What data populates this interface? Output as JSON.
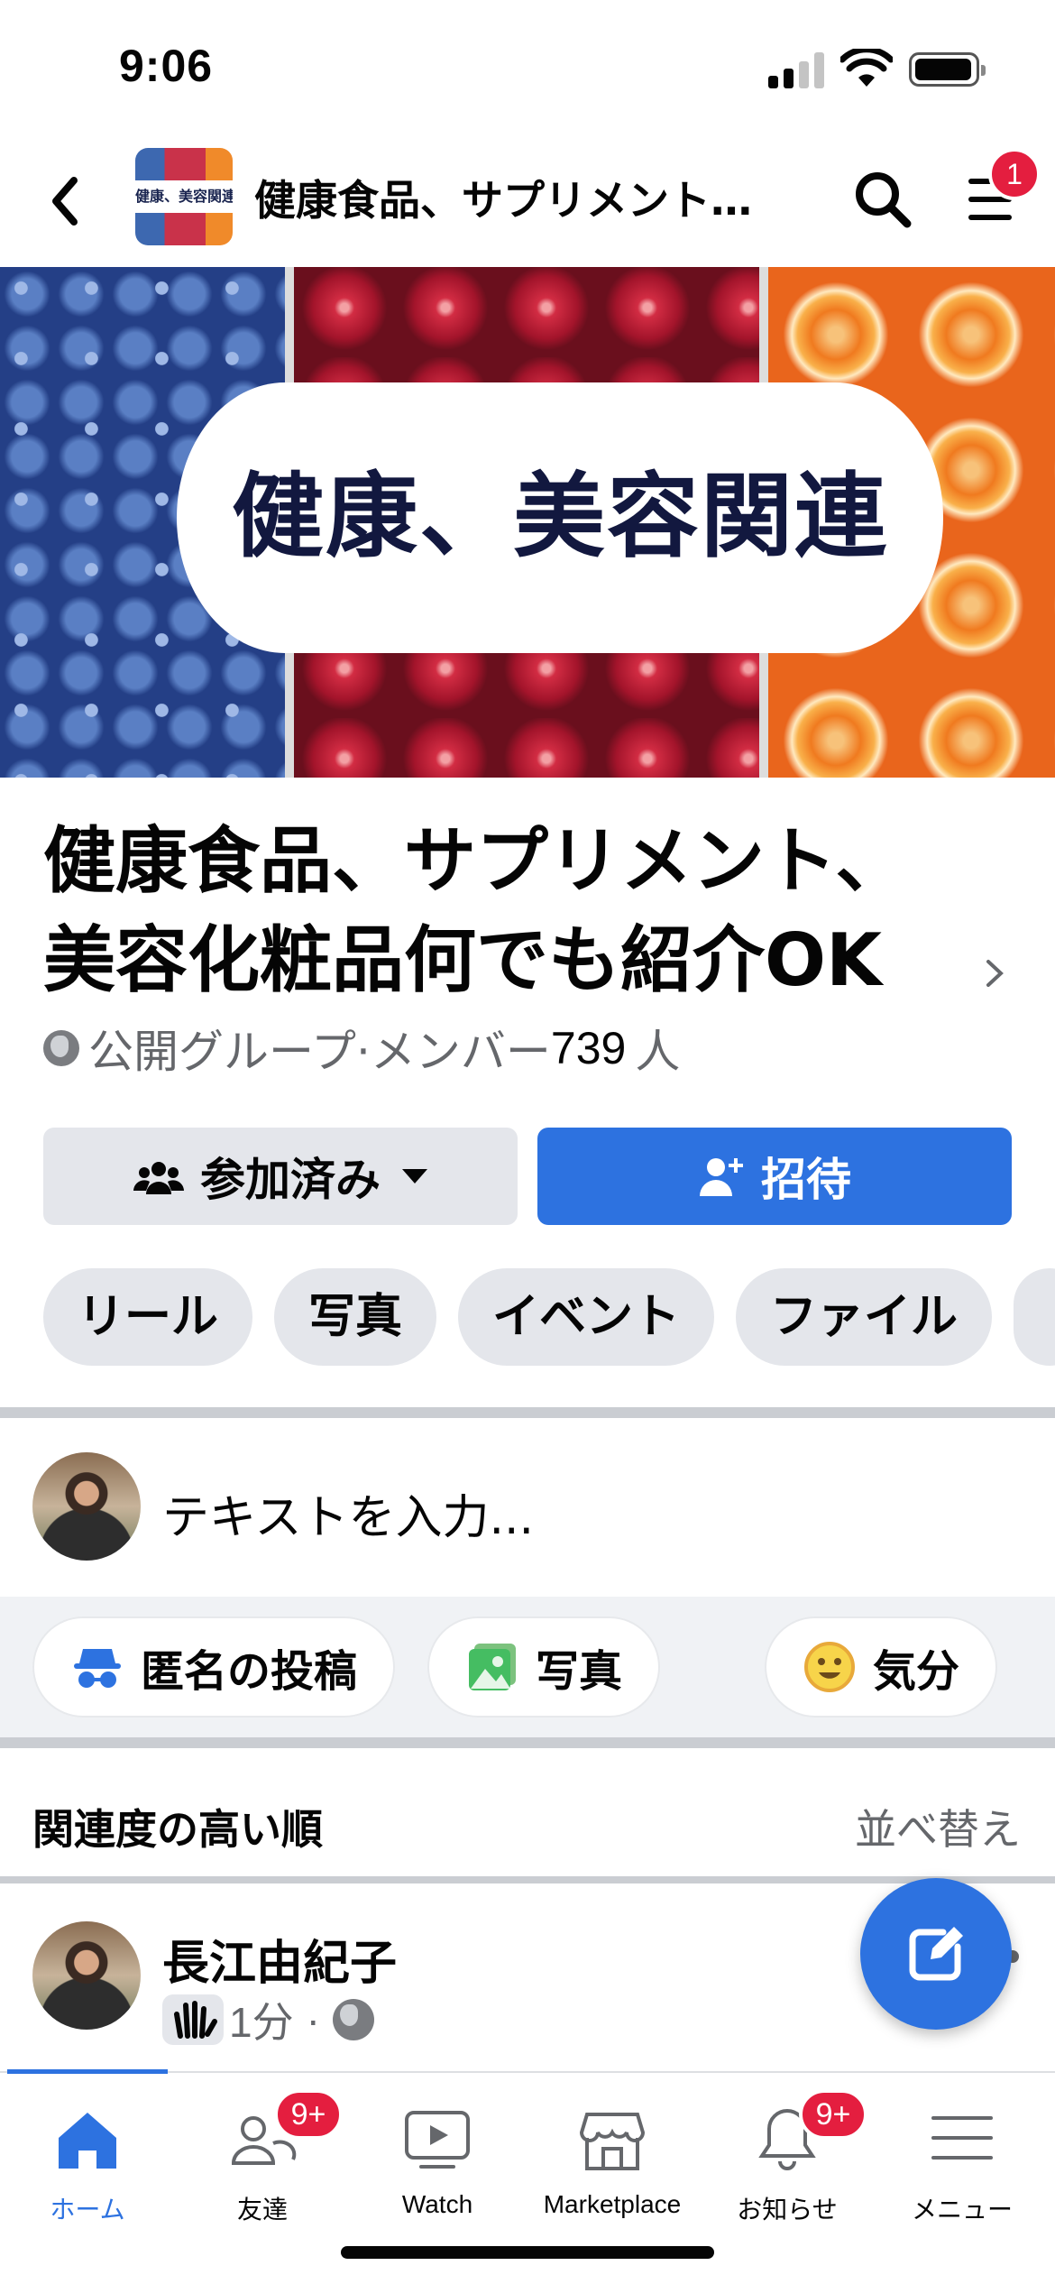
{
  "status_bar": {
    "time": "9:06"
  },
  "header": {
    "title": "健康食品、サプリメント…",
    "thumbnail_label": "健康、美容関連",
    "menu_badge": "1"
  },
  "cover": {
    "banner_text": "健康、美容関連"
  },
  "group": {
    "name_line1": "健康食品、サプリメント、",
    "name_line2": "美容化粧品何でも紹介OK",
    "privacy": "公開グループ·メンバー",
    "member_count": "739",
    "member_unit": "人"
  },
  "actions": {
    "joined_label": "参加済み",
    "invite_label": "招待"
  },
  "chips": [
    "リール",
    "写真",
    "イベント",
    "ファイル"
  ],
  "composer": {
    "placeholder": "テキストを入力..."
  },
  "post_options": {
    "anonymous": "匿名の投稿",
    "photo": "写真",
    "feeling": "気分"
  },
  "sort": {
    "label": "関連度の高い順",
    "action": "並べ替え"
  },
  "post": {
    "author": "長江由紀子",
    "time": "1分",
    "separator": "·"
  },
  "tabbar": {
    "home": "ホーム",
    "friends": "友達",
    "friends_badge": "9+",
    "watch": "Watch",
    "marketplace": "Marketplace",
    "notifications": "お知らせ",
    "notifications_badge": "9+",
    "menu": "メニュー"
  },
  "colors": {
    "accent": "#2d72e0",
    "badge": "#e41e3f",
    "chip_bg": "#e4e6eb",
    "muted": "#65676b"
  }
}
